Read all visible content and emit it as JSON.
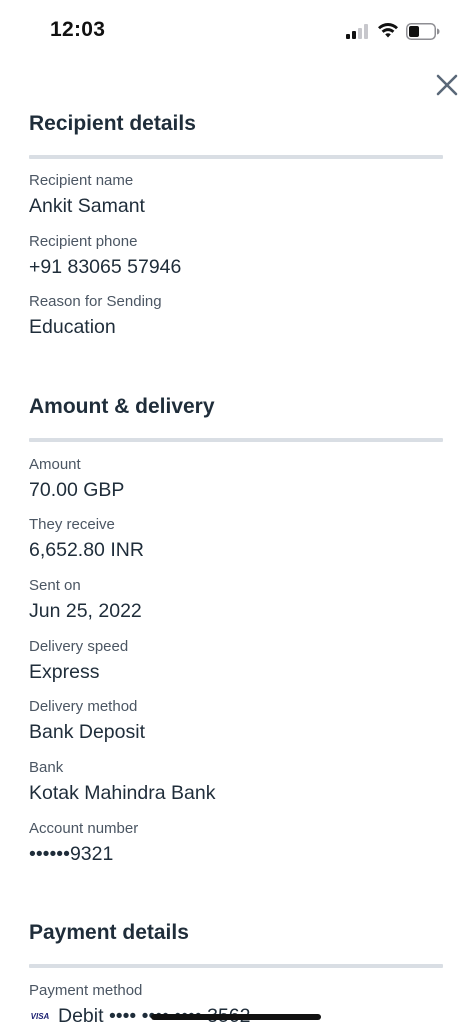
{
  "status_bar": {
    "time": "12:03",
    "icons": [
      "signal-icon",
      "wifi-icon",
      "battery-icon"
    ]
  },
  "close_icon": "close-icon",
  "recipient": {
    "title": "Recipient details",
    "name_label": "Recipient name",
    "name_value": "Ankit Samant",
    "phone_label": "Recipient phone",
    "phone_value": "+91 83065 57946",
    "reason_label": "Reason for Sending",
    "reason_value": "Education"
  },
  "amount": {
    "title": "Amount & delivery",
    "amount_label": "Amount",
    "amount_value": "70.00 GBP",
    "receive_label": "They receive",
    "receive_value": "6,652.80 INR",
    "sent_label": "Sent on",
    "sent_value": "Jun 25, 2022",
    "speed_label": "Delivery speed",
    "speed_value": "Express",
    "method_label": "Delivery method",
    "method_value": "Bank Deposit",
    "bank_label": "Bank",
    "bank_value": "Kotak Mahindra Bank",
    "account_label": "Account number",
    "account_value": "••••••9321"
  },
  "payment": {
    "title": "Payment details",
    "method_label": "Payment method",
    "method_value": "Debit •••• •••• •••• 3562",
    "card_brand": "VISA"
  },
  "colors": {
    "text": "#1f2d3a",
    "label": "#4b5663",
    "divider": "#d9dee4",
    "close": "#5a6878"
  }
}
